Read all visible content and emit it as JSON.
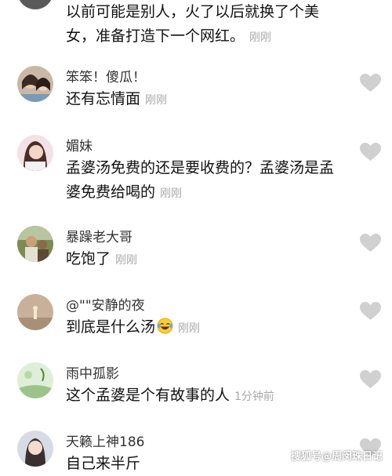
{
  "comments": [
    {
      "username": "",
      "text": "以前可能是别人，火了以后就换了个美女，准备打造下一个网红。",
      "time": "刚刚"
    },
    {
      "username": "笨笨！傻瓜！",
      "text": "还有忘情面",
      "time": "刚刚"
    },
    {
      "username": "媚妹",
      "text": "孟婆汤免费的还是要收费的？孟婆汤是孟婆免费给喝的",
      "time": "刚刚"
    },
    {
      "username": "暴躁老大哥",
      "text": "吃饱了",
      "time": "刚刚"
    },
    {
      "username": "@\"\"安静的夜",
      "text": "到底是什么汤",
      "time": "刚刚",
      "emoji": "laughing-tears-emoji"
    },
    {
      "username": "雨中孤影",
      "text": "这个孟婆是个有故事的人",
      "time": "1分钟前"
    },
    {
      "username": "天籁上神186",
      "text": "自己来半斤",
      "time": ""
    }
  ],
  "watermark": "搜狐号@周闵珠日记",
  "colors": {
    "time": "#a8a8a8",
    "heart": "#cccccc",
    "text": "#111111"
  }
}
